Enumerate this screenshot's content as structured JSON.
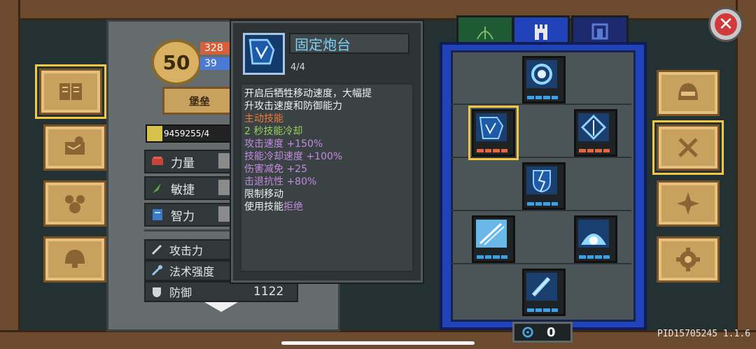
{
  "character": {
    "level": "50",
    "hp": "328",
    "mp": "39",
    "rank_label": "堡垒",
    "exp_text": "9459255/4",
    "exp_fraction": 0.18,
    "attributes": [
      {
        "label": "力量",
        "icon": "fist-icon"
      },
      {
        "label": "敏捷",
        "icon": "feather-icon"
      },
      {
        "label": "智力",
        "icon": "book-icon"
      }
    ],
    "stats": [
      {
        "label": "攻击力",
        "value": "",
        "icon": "sword-icon"
      },
      {
        "label": "法术强度",
        "value": "",
        "icon": "wand-icon"
      },
      {
        "label": "防御",
        "value": "1122",
        "icon": "shield-icon"
      }
    ]
  },
  "tooltip": {
    "name": "固定炮台",
    "level": "4/4",
    "lines": [
      {
        "text": "开启后牺牲移动速度，大幅提",
        "color": "white"
      },
      {
        "text": "升攻击速度和防御能力",
        "color": "white"
      },
      {
        "text": "主动技能",
        "color": "orange"
      },
      {
        "text": "2 秒技能冷却",
        "color": "green"
      },
      {
        "text": "攻击速度 +150%",
        "color": "purple"
      },
      {
        "text": "技能冷却速度 +100%",
        "color": "purple"
      },
      {
        "text": "伤害减免 +25",
        "color": "purple"
      },
      {
        "text": "击退抗性 +80%",
        "color": "purple"
      },
      {
        "text": "限制移动",
        "color": "white"
      }
    ],
    "last_line_prefix": "使用技能",
    "last_line_highlight": "拒绝"
  },
  "skill_tabs": [
    {
      "name": "tab-bow",
      "icon": "bow-icon",
      "active": false
    },
    {
      "name": "tab-castle",
      "icon": "castle-icon",
      "active": true
    },
    {
      "name": "tab-gate",
      "icon": "gate-icon",
      "active": false
    }
  ],
  "skill_points": "0",
  "version": "PID15705245 1.1.6",
  "side_left": [
    "journal-icon",
    "map-icon",
    "bestiary-icon",
    "helmet-icon"
  ],
  "side_right": [
    "helmet-icon",
    "swords-icon",
    "compass-icon",
    "gear-icon"
  ],
  "colors": {
    "frame_blue": "#2142b8",
    "accent_gold": "#f2c744",
    "tooltip_name": "#7ed0f8",
    "close_red": "#d23a3a"
  }
}
